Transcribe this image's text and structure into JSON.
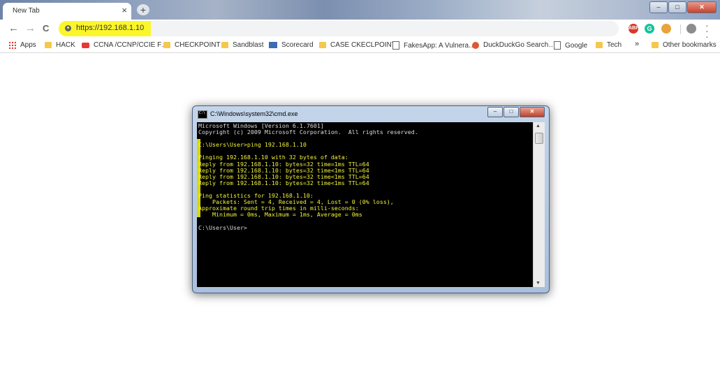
{
  "browser": {
    "tab": {
      "title": "New Tab",
      "close_glyph": "×"
    },
    "newtab_glyph": "+",
    "window_controls": {
      "minimize": "–",
      "maximize": "□",
      "close": "✕"
    },
    "nav": {
      "back": "←",
      "forward": "→",
      "reload": "C"
    },
    "address": {
      "url": "https://192.168.1.10",
      "highlight_color": "#fbf62a"
    },
    "extensions": [
      {
        "icon": "adblock-plus-icon",
        "text": "ABP",
        "color": "#d9372a"
      },
      {
        "icon": "grammarly-icon",
        "text": "G",
        "color": "#15c39a"
      },
      {
        "icon": "cookie-icon",
        "text": "",
        "color": "#e8a43a"
      },
      {
        "icon": "profile-avatar-icon",
        "text": "",
        "color": "#8d8d8d"
      }
    ],
    "bookmarks": [
      {
        "label": "Apps",
        "icon": "apps-grid-icon"
      },
      {
        "label": "HACK",
        "icon": "folder-icon"
      },
      {
        "label": "CCNA /CCNP/CCIE F…",
        "icon": "youtube-icon"
      },
      {
        "label": "CHECKPOINT",
        "icon": "folder-icon"
      },
      {
        "label": "Sandblast",
        "icon": "folder-icon"
      },
      {
        "label": "Scorecard",
        "icon": "scorecard-icon"
      },
      {
        "label": "CASE CKECLPOINT",
        "icon": "folder-icon"
      },
      {
        "label": "FakesApp: A Vulnera…",
        "icon": "page-icon"
      },
      {
        "label": "DuckDuckGo Search…",
        "icon": "duckduckgo-icon"
      },
      {
        "label": "Google",
        "icon": "page-icon"
      },
      {
        "label": "Tech",
        "icon": "folder-icon"
      }
    ],
    "bookmarks_overflow": "»",
    "other_bookmarks": "Other bookmarks"
  },
  "cmd": {
    "title": "C:\\Windows\\system32\\cmd.exe",
    "controls": {
      "minimize": "–",
      "maximize": "□",
      "close": "✕"
    },
    "lines": [
      "Microsoft Windows [Version 6.1.7601]",
      "Copyright (c) 2009 Microsoft Corporation.  All rights reserved.",
      "",
      "C:\\Users\\User>ping 192.168.1.10",
      "",
      "Pinging 192.168.1.10 with 32 bytes of data:",
      "Reply from 192.168.1.10: bytes=32 time=1ms TTL=64",
      "Reply from 192.168.1.10: bytes=32 time<1ms TTL=64",
      "Reply from 192.168.1.10: bytes=32 time<1ms TTL=64",
      "Reply from 192.168.1.10: bytes=32 time<1ms TTL=64",
      "",
      "Ping statistics for 192.168.1.10:",
      "    Packets: Sent = 4, Received = 4, Lost = 0 (0% loss),",
      "Approximate round trip times in milli-seconds:",
      "    Minimum = 0ms, Maximum = 1ms, Average = 0ms",
      "",
      "C:\\Users\\User>"
    ],
    "scroll": {
      "up": "▲",
      "down": "▼"
    }
  }
}
